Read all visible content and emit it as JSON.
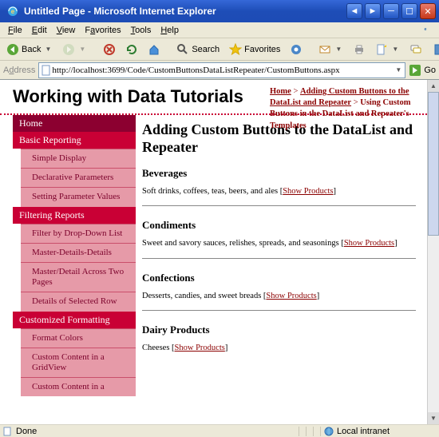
{
  "window": {
    "title": "Untitled Page - Microsoft Internet Explorer"
  },
  "menu": {
    "file": "File",
    "edit": "Edit",
    "view": "View",
    "favorites": "Favorites",
    "tools": "Tools",
    "help": "Help"
  },
  "toolbar": {
    "back": "Back",
    "search": "Search",
    "favorites": "Favorites"
  },
  "address": {
    "label": "Address",
    "url": "http://localhost:3699/Code/CustomButtonsDataListRepeater/CustomButtons.aspx",
    "go": "Go"
  },
  "site": {
    "title": "Working with Data Tutorials"
  },
  "breadcrumb": {
    "home": "Home",
    "section": "Adding Custom Buttons to the DataList and Repeater",
    "current": "Using Custom Buttons in the DataList and Repeater's Templates",
    "sep1": " > ",
    "sep2": " > "
  },
  "nav": {
    "home": "Home",
    "basic_reporting": "Basic Reporting",
    "simple_display": "Simple Display",
    "declarative_params": "Declarative Parameters",
    "setting_param_values": "Setting Parameter Values",
    "filtering_reports": "Filtering Reports",
    "filter_dropdown": "Filter by Drop-Down List",
    "master_details_details": "Master-Details-Details",
    "master_detail_two_pages": "Master/Detail Across Two Pages",
    "details_selected_row": "Details of Selected Row",
    "customized_formatting": "Customized Formatting",
    "format_colors": "Format Colors",
    "custom_content_gridview": "Custom Content in a GridView",
    "custom_content_in_a": "Custom Content in a"
  },
  "main": {
    "heading": "Adding Custom Buttons to the DataList and Repeater",
    "show_products": "Show Products",
    "categories": [
      {
        "name": "Beverages",
        "desc": "Soft drinks, coffees, teas, beers, and ales"
      },
      {
        "name": "Condiments",
        "desc": "Sweet and savory sauces, relishes, spreads, and seasonings"
      },
      {
        "name": "Confections",
        "desc": "Desserts, candies, and sweet breads"
      },
      {
        "name": "Dairy Products",
        "desc": "Cheeses"
      }
    ]
  },
  "status": {
    "done": "Done",
    "zone": "Local intranet"
  }
}
